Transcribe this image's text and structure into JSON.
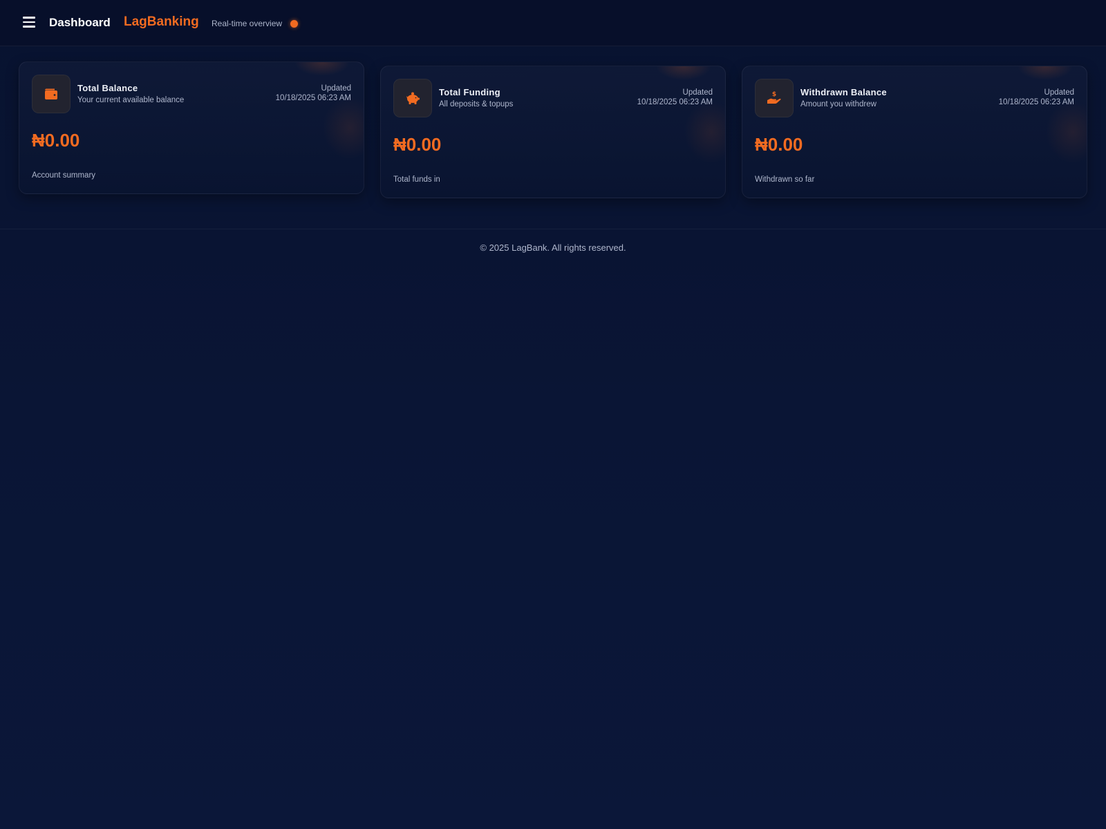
{
  "header": {
    "title": "Dashboard",
    "brand": "LagBanking",
    "subtitle": "Real-time overview",
    "live_indicator_color": "#f26b21",
    "menu_icon": "hamburger-menu-icon"
  },
  "cards": [
    {
      "title": "Total Balance",
      "description": "Your current available balance",
      "updated_label": "Updated",
      "updated_time": "10/18/2025 06:23 AM",
      "amount": "₦0.00",
      "footer": "Account summary",
      "icon": "wallet-icon"
    },
    {
      "title": "Total Funding",
      "description": "All deposits & topups",
      "updated_label": "Updated",
      "updated_time": "10/18/2025 06:23 AM",
      "amount": "₦0.00",
      "footer": "Total funds in",
      "icon": "piggy-bank-icon"
    },
    {
      "title": "Withdrawn Balance",
      "description": "Amount you withdrew",
      "updated_label": "Updated",
      "updated_time": "10/18/2025 06:23 AM",
      "amount": "₦0.00",
      "footer": "Withdrawn so far",
      "icon": "hand-holding-dollar-icon"
    }
  ],
  "footer": {
    "copyright": "© 2025 LagBank. All rights reserved."
  },
  "colors": {
    "accent": "#f26b21",
    "background": "#0a1535",
    "muted_text": "#aeb6cc"
  }
}
